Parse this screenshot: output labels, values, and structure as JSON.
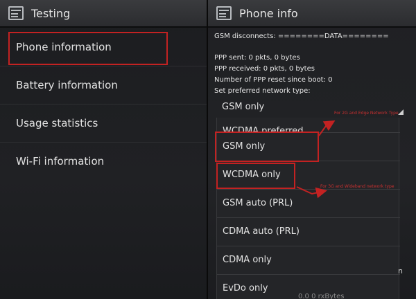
{
  "left_panel": {
    "title": "Testing",
    "icon": "settings-app-icon",
    "items": [
      {
        "label": "Phone information"
      },
      {
        "label": "Battery information"
      },
      {
        "label": "Usage statistics"
      },
      {
        "label": "Wi-Fi information"
      }
    ]
  },
  "right_panel": {
    "title": "Phone info",
    "icon": "settings-app-icon",
    "info_lines": [
      "GSM disconnects: ========DATA========",
      "PPP sent: 0 pkts, 0 bytes",
      "PPP received: 0 pkts, 0 bytes",
      "Number of PPP reset since boot: 0",
      "Set preferred network type:"
    ],
    "spinner_value": "GSM only",
    "dropdown_cut_label": "WCDMA preferred",
    "dropdown_options": [
      {
        "label": "GSM only"
      },
      {
        "label": "WCDMA only"
      },
      {
        "label": "GSM auto (PRL)"
      },
      {
        "label": "CDMA auto (PRL)"
      },
      {
        "label": "CDMA only"
      },
      {
        "label": "EvDo only"
      }
    ],
    "annotations": {
      "note_1": "For 2G and Edge Network Type",
      "note_2": "For 3G and Wideband network type"
    },
    "behind_char": "n",
    "bottom_text": "0.0 0 rxBytes"
  },
  "colors": {
    "highlight": "#c32222",
    "background": "#1f2023",
    "text": "#e6e6e6"
  }
}
